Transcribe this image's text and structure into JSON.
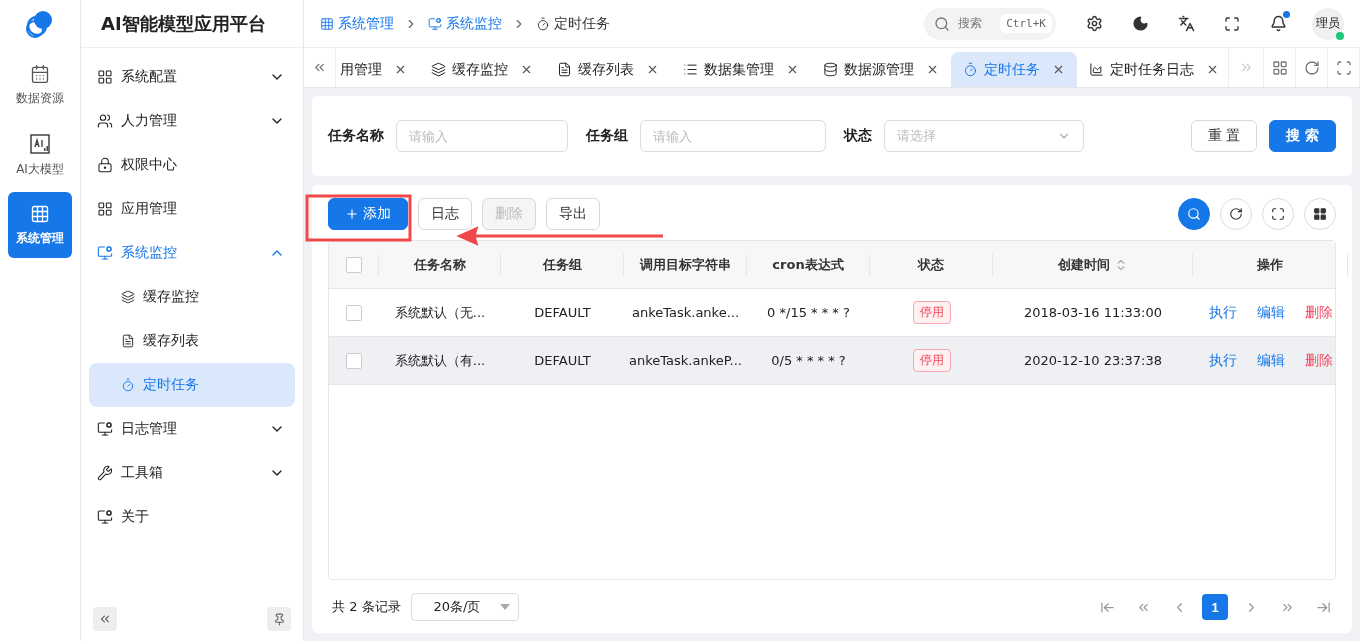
{
  "rail": {
    "items": [
      {
        "label": "数据资源",
        "selected": false
      },
      {
        "label": "AI大模型",
        "selected": false
      },
      {
        "label": "系统管理",
        "selected": true
      }
    ]
  },
  "sidebar": {
    "title": "AI智能模型应用平台",
    "items": [
      {
        "label": "系统配置",
        "selected": false,
        "expanded": false
      },
      {
        "label": "人力管理",
        "selected": false,
        "expanded": false
      },
      {
        "label": "权限中心",
        "selected": false
      },
      {
        "label": "应用管理",
        "selected": false
      },
      {
        "label": "系统监控",
        "selected": true,
        "expanded": true,
        "children": [
          {
            "label": "缓存监控",
            "selected": false
          },
          {
            "label": "缓存列表",
            "selected": false
          },
          {
            "label": "定时任务",
            "selected": true
          }
        ]
      },
      {
        "label": "日志管理",
        "selected": false,
        "expanded": false
      },
      {
        "label": "工具箱",
        "selected": false,
        "expanded": false
      },
      {
        "label": "关于",
        "selected": false
      }
    ]
  },
  "breadcrumb": [
    {
      "label": "系统管理",
      "current": false
    },
    {
      "label": "系统监控",
      "current": false
    },
    {
      "label": "定时任务",
      "current": true
    }
  ],
  "search": {
    "placeholder": "搜索",
    "shortcut": "Ctrl+K"
  },
  "user": {
    "name": "理员",
    "online": true
  },
  "notifications": {
    "unread": true
  },
  "tabs": [
    {
      "label": "用管理",
      "selected": false
    },
    {
      "label": "缓存监控",
      "selected": false
    },
    {
      "label": "缓存列表",
      "selected": false
    },
    {
      "label": "数据集管理",
      "selected": false
    },
    {
      "label": "数据源管理",
      "selected": false
    },
    {
      "label": "定时任务",
      "selected": true
    },
    {
      "label": "定时任务日志",
      "selected": false
    }
  ],
  "filters": [
    {
      "label": "任务名称",
      "kind": "input",
      "placeholder": "请输入"
    },
    {
      "label": "任务组",
      "kind": "input",
      "placeholder": "请输入"
    },
    {
      "label": "状态",
      "kind": "select",
      "placeholder": "请选择"
    }
  ],
  "filter_buttons": [
    "重 置",
    "搜 索"
  ],
  "toolbar": [
    {
      "label": "添加",
      "disabled": false
    },
    {
      "label": "日志",
      "disabled": false
    },
    {
      "label": "删除",
      "disabled": true
    },
    {
      "label": "导出",
      "disabled": false
    }
  ],
  "table": {
    "all_checked": false,
    "columns": [
      "任务名称",
      "任务组",
      "调用目标字符串",
      "cron表达式",
      "状态",
      "创建时间",
      "操作"
    ],
    "rows": [
      {
        "checked": false,
        "hovered": false,
        "cells": [
          "系统默认（无...",
          "DEFAULT",
          "ankeTask.anke...",
          "0 */15 * * * ?"
        ],
        "status": "停用",
        "created": "2018-03-16 11:33:00",
        "actions": [
          "执行",
          "编辑",
          "删除"
        ]
      },
      {
        "checked": false,
        "hovered": true,
        "cells": [
          "系统默认（有...",
          "DEFAULT",
          "ankeTask.ankeP...",
          "0/5 * * * * ?"
        ],
        "status": "停用",
        "created": "2020-12-10 23:37:38",
        "actions": [
          "执行",
          "编辑",
          "删除"
        ]
      }
    ]
  },
  "pagination": {
    "total": "共 2 条记录",
    "page_size": "20条/页",
    "pages": [
      {
        "label": "1",
        "selected": true
      }
    ]
  },
  "annotations": {
    "highlight_box": {
      "color": "#f04848"
    },
    "arrow": {
      "color": "#f04848"
    }
  }
}
